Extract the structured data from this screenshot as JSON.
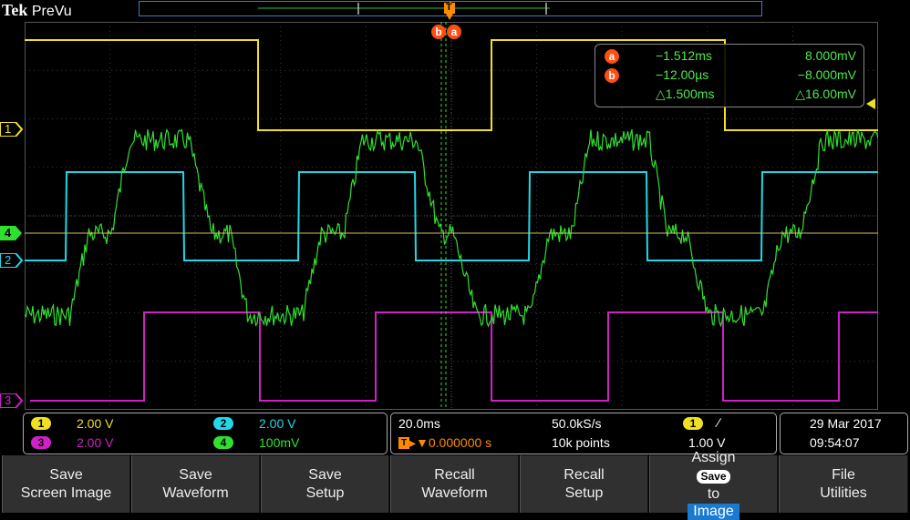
{
  "brand": {
    "maker": "Tek",
    "mode": "PreVu"
  },
  "trigger_marker": "T",
  "cursor_labels": {
    "b": "b",
    "a": "a"
  },
  "channel_markers": {
    "ch1": "1",
    "ch2": "2",
    "ch3": "3",
    "ch4": "4"
  },
  "cursor_readout": {
    "a": {
      "time": "−1.512ms",
      "value": "8.000mV"
    },
    "b": {
      "time": "−12.00µs",
      "value": "−8.000mV"
    },
    "delta": {
      "time": "△1.500ms",
      "value": "△16.00mV"
    }
  },
  "channels": [
    {
      "id": "1",
      "scale": "2.00 V",
      "color": "#f0e020"
    },
    {
      "id": "2",
      "scale": "2.00 V",
      "color": "#20d8e8"
    },
    {
      "id": "3",
      "scale": "2.00 V",
      "color": "#d020c8"
    },
    {
      "id": "4",
      "scale": "100mV",
      "color": "#30e030"
    }
  ],
  "horizontal": {
    "timebase": "20.0ms",
    "sample_rate": "50.0kS/s",
    "trigger_pos": "▸▼0.000000 s",
    "record_length": "10k points",
    "trigger_source": "1",
    "trigger_slope": "∕",
    "trigger_level": "1.00 V"
  },
  "datetime": {
    "date": "29 Mar  2017",
    "time": "09:54:07"
  },
  "menu": [
    {
      "line1": "Save",
      "line2": "Screen Image"
    },
    {
      "line1": "Save",
      "line2": "Waveform"
    },
    {
      "line1": "Save",
      "line2": "Setup"
    },
    {
      "line1": "Recall",
      "line2": "Waveform"
    },
    {
      "line1": "Recall",
      "line2": "Setup"
    },
    {
      "line1": "Assign",
      "save_chip": "Save",
      "to": "to",
      "line3": "Image"
    },
    {
      "line1": "File",
      "line2": "Utilities"
    }
  ],
  "colors": {
    "grid": "#3a3a3a",
    "ch1": "#f0e020",
    "ch2": "#20d8e8",
    "ch3": "#d020c8",
    "ch4": "#30e030",
    "cursor": "#ff4e14"
  }
}
